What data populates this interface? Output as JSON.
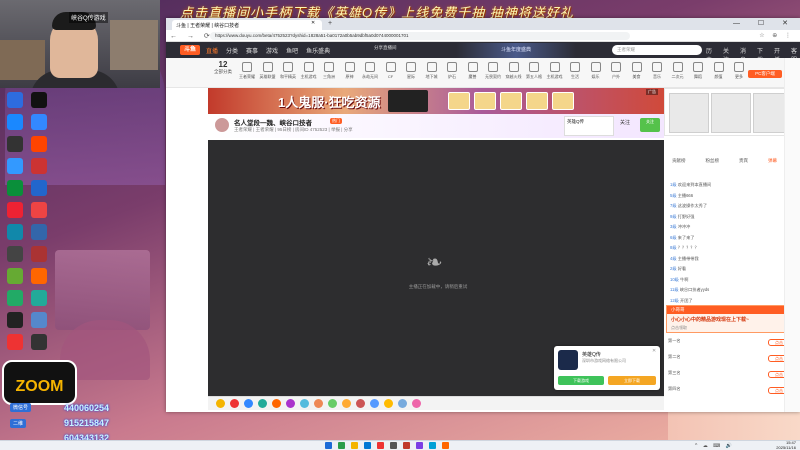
{
  "banner_text": "点击直播间小手柄下载《英雄Q传》上线免费千抽 抽神将送好礼",
  "webcam": {
    "label": "峡谷Q传游戏"
  },
  "desktop_icons": [
    {
      "label": "",
      "color": "#2d6cdf"
    },
    {
      "label": "",
      "color": "#1a88ff"
    },
    {
      "label": "",
      "color": "#333"
    },
    {
      "label": "",
      "color": "#3399ff"
    },
    {
      "label": "",
      "color": "#0a8f3a"
    },
    {
      "label": "",
      "color": "#e23"
    },
    {
      "label": "",
      "color": "#18a"
    },
    {
      "label": "",
      "color": "#444"
    },
    {
      "label": "",
      "color": "#6a3"
    },
    {
      "label": "",
      "color": "#2a6"
    },
    {
      "label": "",
      "color": "#222"
    },
    {
      "label": "",
      "color": "#e33"
    },
    {
      "label": "",
      "color": "#111"
    },
    {
      "label": "",
      "color": "#38f"
    },
    {
      "label": "",
      "color": "#f40"
    },
    {
      "label": "",
      "color": "#c33"
    },
    {
      "label": "",
      "color": "#26c"
    },
    {
      "label": "",
      "color": "#e44"
    },
    {
      "label": "",
      "color": "#36a"
    },
    {
      "label": "",
      "color": "#a33"
    },
    {
      "label": "",
      "color": "#f60"
    },
    {
      "label": "",
      "color": "#2a9"
    },
    {
      "label": "",
      "color": "#58c"
    },
    {
      "label": "",
      "color": "#333"
    }
  ],
  "browser": {
    "tab_title": "斗鱼 | 王者荣耀 | 峡谷口技者",
    "url": "https://www.douyu.com/beta/4752523?dyshid=1828a51-ba0172a0b5ab9dbf5a0d0744000001701",
    "win_controls": "— ☐ ✕"
  },
  "douyu": {
    "logo": "斗鱼",
    "menu": [
      "直播",
      "分类",
      "赛事",
      "游戏",
      "鱼吧",
      "鱼乐盛典"
    ],
    "upload_label": "分享直播间",
    "head_art": "斗鱼年度盛典",
    "search_placeholder": "王者荣耀",
    "right_menu": [
      "历史",
      "关注",
      "消息",
      "下载",
      "开播",
      "客服"
    ],
    "category_count": "12",
    "category_count_label": "全部分类",
    "categories": [
      "王者荣耀",
      "英雄联盟",
      "和平精英",
      "主机游戏",
      "三角洲",
      "原神",
      "永劫无间",
      "CF",
      "星际",
      "地下城",
      "炉石",
      "魔兽",
      "无畏契约",
      "穿越火线",
      "第五人格",
      "主机游戏",
      "生活",
      "娱乐",
      "户外",
      "美食",
      "音乐",
      "二次元",
      "舞蹈",
      "颜值",
      "更多"
    ],
    "pc_client": "PC客户端"
  },
  "ad": {
    "title": "1人鬼服·狂吃资源",
    "badge": "广告"
  },
  "room": {
    "title": "名人堂段一魏、峡谷口技者",
    "hot": "热门",
    "sub": "王者荣耀 | 王者荣耀 | 95日榜 | 房间ID 4752523 | 举报 | 分享",
    "game_box": "英雄Q传",
    "follow": "关注",
    "follow_orange": "关注"
  },
  "player": {
    "msg": "主播正在加载中，请稍后重试"
  },
  "game_popup": {
    "name": "英雄Q传",
    "company": "深圳市游戏网络有限公司",
    "btn1": "下载游戏",
    "btn2": "立即下载"
  },
  "side_tabs": [
    "贡献榜",
    "粉丝榜",
    "贵宾",
    "弹幕"
  ],
  "chat_lines": [
    {
      "user": "1级",
      "text": "欢迎来到本直播间"
    },
    {
      "user": "5级",
      "text": "主播666"
    },
    {
      "user": "7级",
      "text": "这波操作太秀了"
    },
    {
      "user": "9级",
      "text": "打野好强"
    },
    {
      "user": "3级",
      "text": "冲冲冲"
    },
    {
      "user": "6级",
      "text": "来了来了"
    },
    {
      "user": "8级",
      "text": "？？？？？"
    },
    {
      "user": "4级",
      "text": "主播带带我"
    },
    {
      "user": "2级",
      "text": "好看"
    },
    {
      "user": "10级",
      "text": "牛啊"
    },
    {
      "user": "11级",
      "text": "峡谷口技者yyds"
    },
    {
      "user": "12级",
      "text": "开团了"
    }
  ],
  "promo": {
    "head": "小哥哥",
    "text": "小心小心中的精品游戏现在上下载~",
    "sub": "点击领取"
  },
  "ranks": [
    {
      "name": "第一名",
      "btn": "点击"
    },
    {
      "name": "第二名",
      "btn": "点击"
    },
    {
      "name": "第三名",
      "btn": "点击"
    },
    {
      "name": "第四名",
      "btn": "点击"
    }
  ],
  "overlay": {
    "logo": "ZOOM",
    "wechat1": "微信号",
    "wechat2": "二维",
    "qq1": "440060254",
    "qq2": "915215847",
    "qq3": "604343132"
  },
  "taskbar": {
    "time": "15:47",
    "date": "2025/11/16",
    "icons": [
      "#1d6bd6",
      "#2a9d4a",
      "#f4b400",
      "#0078d4",
      "#e33",
      "#555",
      "#c0392b",
      "#7b3fe4",
      "#00a1d6",
      "#f60"
    ]
  }
}
